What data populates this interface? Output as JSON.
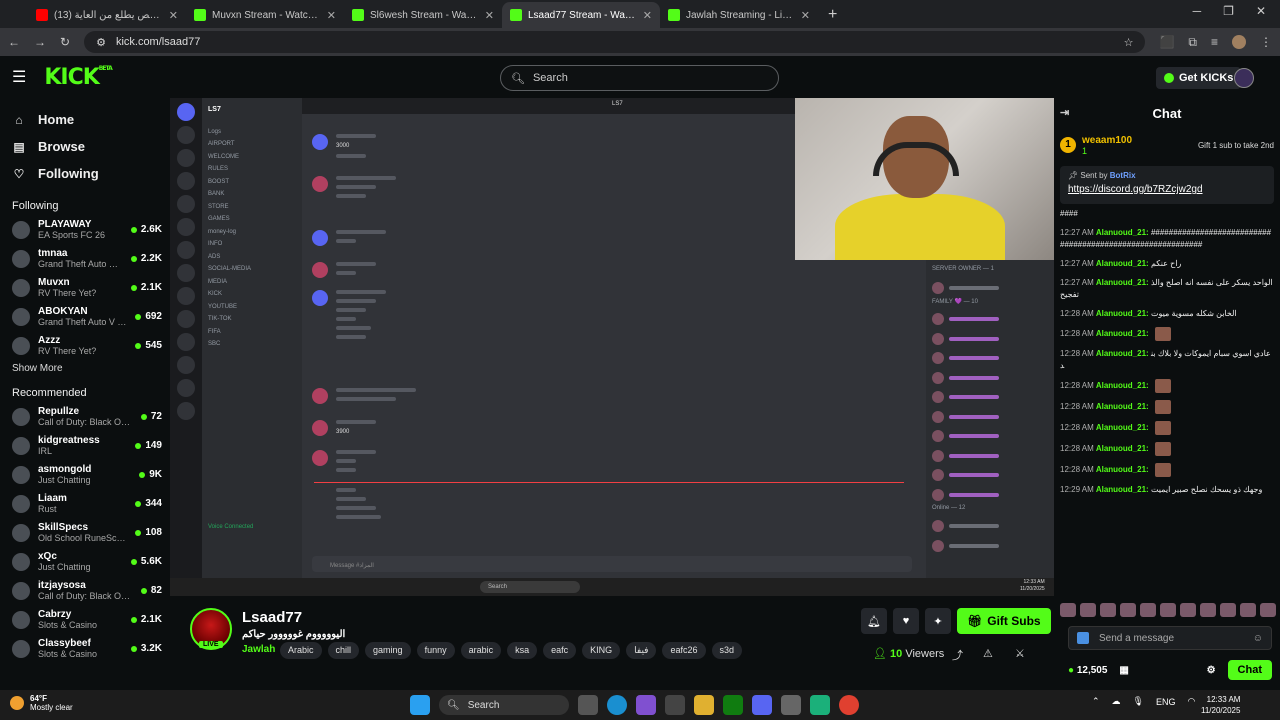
{
  "browser": {
    "tabs": [
      {
        "title": "(13) احر شخص يطلع من العاية",
        "icon": "youtube-icon",
        "active": false
      },
      {
        "title": "Muvxn Stream - Watch Live on",
        "icon": "kick-icon",
        "active": false
      },
      {
        "title": "Sl6wesh Stream - Watch Live o",
        "icon": "kick-icon",
        "active": false
      },
      {
        "title": "Lsaad77 Stream - Watch Live o",
        "icon": "kick-icon",
        "active": true
      },
      {
        "title": "Jawlah Streaming - Live Stream",
        "icon": "kick-icon",
        "active": false
      }
    ],
    "new_tab": "+",
    "url": "kick.com/lsaad77"
  },
  "header": {
    "logo": "KICK",
    "logo_badge": "BETA",
    "search_placeholder": "Search",
    "get_kicks": "Get KICKs"
  },
  "sidebar": {
    "nav": [
      {
        "label": "Home",
        "icon": "home-icon"
      },
      {
        "label": "Browse",
        "icon": "browse-icon"
      },
      {
        "label": "Following",
        "icon": "heart-icon"
      }
    ],
    "following_title": "Following",
    "following": [
      {
        "name": "PLAYAWAY",
        "category": "EA Sports FC 26",
        "viewers": "2.6K"
      },
      {
        "name": "tmnaa",
        "category": "Grand Theft Auto V (...",
        "viewers": "2.2K"
      },
      {
        "name": "Muvxn",
        "category": "RV There Yet?",
        "viewers": "2.1K"
      },
      {
        "name": "ABOKYAN",
        "category": "Grand Theft Auto V (G...",
        "viewers": "692"
      },
      {
        "name": "Azzz",
        "category": "RV There Yet?",
        "viewers": "545"
      }
    ],
    "show_more": "Show More",
    "recommended_title": "Recommended",
    "recommended": [
      {
        "name": "Repullze",
        "category": "Call of Duty: Black Ops 7",
        "viewers": "72"
      },
      {
        "name": "kidgreatness",
        "category": "IRL",
        "viewers": "149"
      },
      {
        "name": "asmongold",
        "category": "Just Chatting",
        "viewers": "9K"
      },
      {
        "name": "Liaam",
        "category": "Rust",
        "viewers": "344"
      },
      {
        "name": "SkillSpecs",
        "category": "Old School RuneScape",
        "viewers": "108"
      },
      {
        "name": "xQc",
        "category": "Just Chatting",
        "viewers": "5.6K"
      },
      {
        "name": "itzjaysosa",
        "category": "Call of Duty: Black Ops 7",
        "viewers": "82"
      },
      {
        "name": "Cabrzy",
        "category": "Slots & Casino",
        "viewers": "2.1K"
      },
      {
        "name": "Classybeef",
        "category": "Slots & Casino",
        "viewers": "3.2K"
      }
    ]
  },
  "stream_overlay": {
    "server_name": "LS7",
    "top_label": "LS7",
    "channels": [
      "Logs",
      "AIRPORT",
      "WELCOME",
      "RULES",
      "BOOST",
      "BANK",
      "STORE",
      "GAMES",
      "money-log",
      "INFO",
      "ADS",
      "SOCIAL-MEDIA",
      "MEDIA",
      "KICK",
      "YOUTUBE",
      "TIK-TOK",
      "FIFA",
      "SBC"
    ],
    "voice_connected": "Voice Connected",
    "message_placeholder": "Message #المزاد",
    "members_header": "SERVER OWNER — 1",
    "family_header": "FAMILY 💜 — 10",
    "online_header": "Online — 12",
    "msg_values": [
      "3000",
      "3900"
    ],
    "taskbar_search": "Search",
    "clock_time": "12:33 AM",
    "clock_date": "11/20/2025"
  },
  "stream_info": {
    "channel_name": "Lsaad77",
    "title": "اليوووووم غووووور حياكم",
    "category": "Jawlah",
    "live_label": "LIVE",
    "tags": [
      "Arabic",
      "chill",
      "gaming",
      "funny",
      "arabic",
      "ksa",
      "eafc",
      "KING",
      "فيفا",
      "eafc26",
      "s3d"
    ],
    "gift_subs": "Gift Subs",
    "viewers_count": "10",
    "viewers_label": "Viewers"
  },
  "chat": {
    "title": "Chat",
    "top_gifter": {
      "name": "weaam100",
      "rank": "1",
      "count": "1",
      "gift_text": "Gift 1 sub to take 2nd"
    },
    "pinned": {
      "sent_by": "Sent by",
      "bot": "BotRix",
      "link": "https://discord.gg/b7RZcjw2gd"
    },
    "messages": [
      {
        "time": "",
        "user": "",
        "text": "####"
      },
      {
        "time": "12:27 AM",
        "user": "Alanuoud_21:",
        "text": "###########################################################"
      },
      {
        "time": "12:27 AM",
        "user": "Alanuoud_21:",
        "text": "راح عنكم"
      },
      {
        "time": "12:27 AM",
        "user": "Alanuoud_21:",
        "text": "الواحد يسكر على نفسه انه اصلح والذ تفجيح"
      },
      {
        "time": "12:28 AM",
        "user": "Alanuoud_21:",
        "text": "الخابن شكله مسوية ميوت"
      },
      {
        "time": "12:28 AM",
        "user": "Alanuoud_21:",
        "text": ""
      },
      {
        "time": "12:28 AM",
        "user": "Alanuoud_21:",
        "text": "عادي اسوي سبام ايموكات ولا بلاك بند"
      },
      {
        "time": "12:28 AM",
        "user": "Alanuoud_21:",
        "text": ""
      },
      {
        "time": "12:28 AM",
        "user": "Alanuoud_21:",
        "text": ""
      },
      {
        "time": "12:28 AM",
        "user": "Alanuoud_21:",
        "text": ""
      },
      {
        "time": "12:28 AM",
        "user": "Alanuoud_21:",
        "text": ""
      },
      {
        "time": "12:28 AM",
        "user": "Alanuoud_21:",
        "text": ""
      },
      {
        "time": "12:29 AM",
        "user": "Alanuoud_21:",
        "text": "وجهك ذو يسحك نصلح صبير ايميت"
      }
    ],
    "input_placeholder": "Send a message",
    "kicks_balance": "12,505",
    "chat_button": "Chat"
  },
  "taskbar": {
    "weather_temp": "64°F",
    "weather_desc": "Mostly clear",
    "search": "Search",
    "lang": "ENG",
    "time": "12:33 AM",
    "date": "11/20/2025"
  }
}
